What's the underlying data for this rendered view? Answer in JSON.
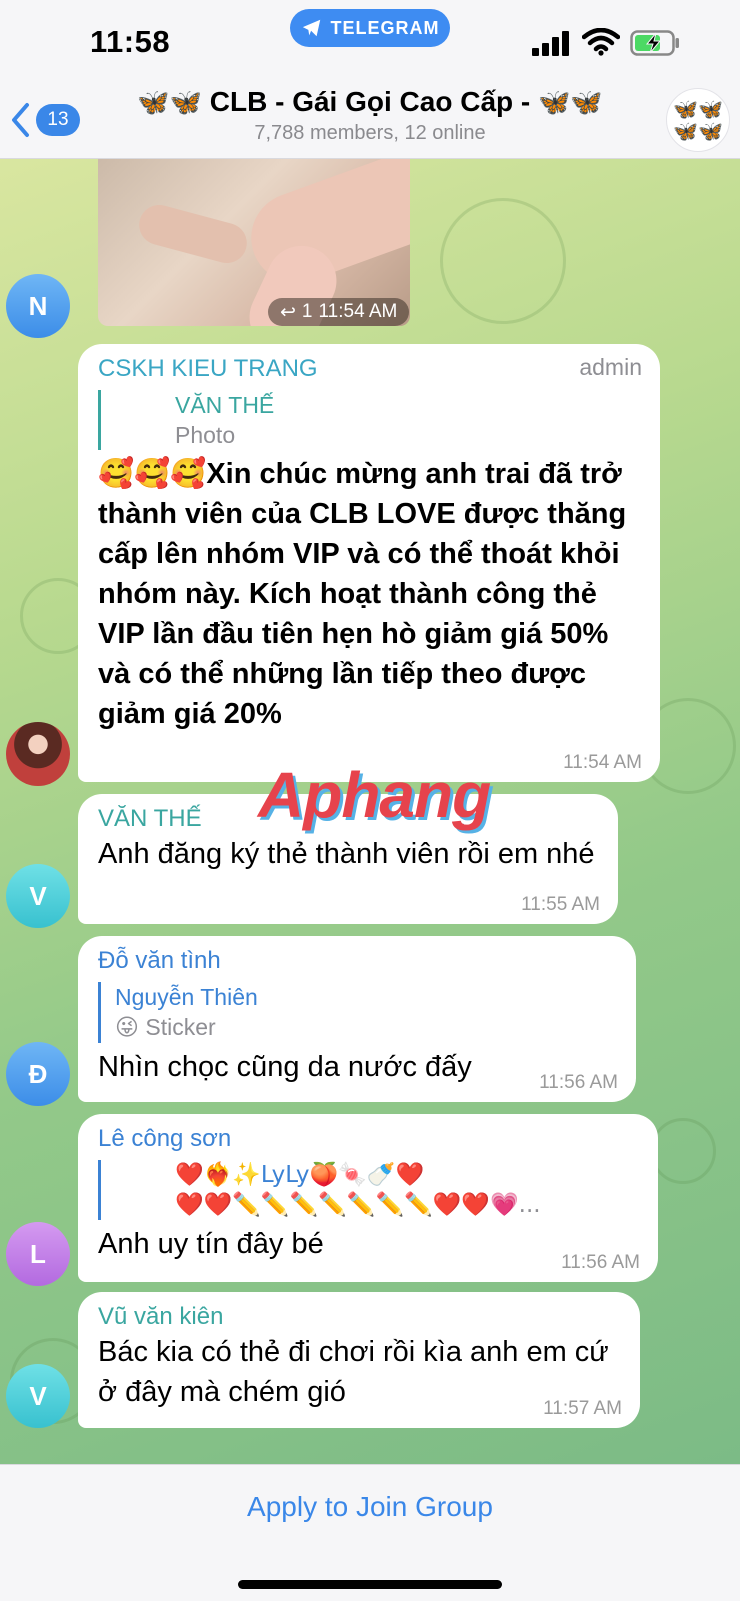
{
  "status_bar": {
    "time": "11:58",
    "app_pill": "TELEGRAM"
  },
  "header": {
    "back_count": "13",
    "title_prefix": "🦋🦋",
    "title": "CLB - Gái Gọi Cao Cấp -",
    "title_suffix": "🦋🦋",
    "subtitle": "7,788 members, 12 online",
    "avatar_icons": "🦋🦋🦋🦋"
  },
  "media_message": {
    "replies": "1",
    "time": "11:54 AM",
    "avatar_initial": "N"
  },
  "messages": [
    {
      "sender": "CSKH KIEU TRANG",
      "role": "admin",
      "reply_name": "VĂN THẾ",
      "reply_sub": "Photo",
      "text": "🥰🥰🥰Xin chúc mừng anh trai đã trở thành viên của CLB LOVE được thăng cấp lên nhóm VIP và có thể thoát khỏi nhóm này. Kích hoạt thành công thẻ VIP lần đầu tiên hẹn hò giảm giá 50% và có thể những lần tiếp theo được giảm giá 20%",
      "time": "11:54 AM"
    },
    {
      "sender": "VĂN THẾ",
      "text": "Anh đăng ký thẻ thành viên rồi em nhé",
      "time": "11:55 AM",
      "avatar_initial": "V"
    },
    {
      "sender": "Đỗ văn tình",
      "reply_name": "Nguyễn Thiên",
      "reply_emoji": "😜",
      "reply_sub": "Sticker",
      "text": "Nhìn chọc cũng da nước đấy",
      "time": "11:56 AM",
      "avatar_initial": "Đ"
    },
    {
      "sender": "Lê công sơn",
      "reply_name": "❤️❤️‍🔥✨LyLy🍑🍬🍼❤️",
      "reply_sub": "❤️❤️✏️✏️✏️✏️✏️✏️✏️❤️❤️💗...",
      "text": "Anh uy tín đây bé",
      "time": "11:56 AM",
      "avatar_initial": "L"
    },
    {
      "sender": "Vũ văn kiên",
      "text": "Bác kia có thẻ đi chơi rồi kìa anh em cứ ở đây mà chém gió",
      "time": "11:57 AM",
      "avatar_initial": "V"
    }
  ],
  "watermark": "Aphang",
  "footer": {
    "join_label": "Apply to Join Group"
  },
  "colors": {
    "accent": "#3a87e8",
    "pill": "#3e8cf2",
    "bubble": "#ffffff",
    "meta": "#8e8e93"
  }
}
